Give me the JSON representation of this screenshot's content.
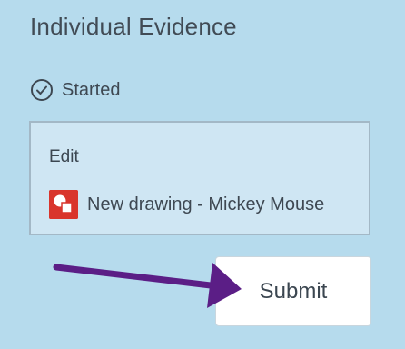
{
  "section": {
    "title": "Individual Evidence",
    "status_label": "Started"
  },
  "card": {
    "edit_label": "Edit",
    "file_name": "New drawing - Mickey Mouse"
  },
  "actions": {
    "submit_label": "Submit"
  },
  "colors": {
    "background": "#b6dbed",
    "card_background": "#cfe6f3",
    "drawing_icon": "#d9352c",
    "annotation_arrow": "#5b1e86"
  },
  "icons": {
    "status": "check-circle-icon",
    "file": "google-drawing-icon",
    "annotation": "arrow-icon"
  }
}
